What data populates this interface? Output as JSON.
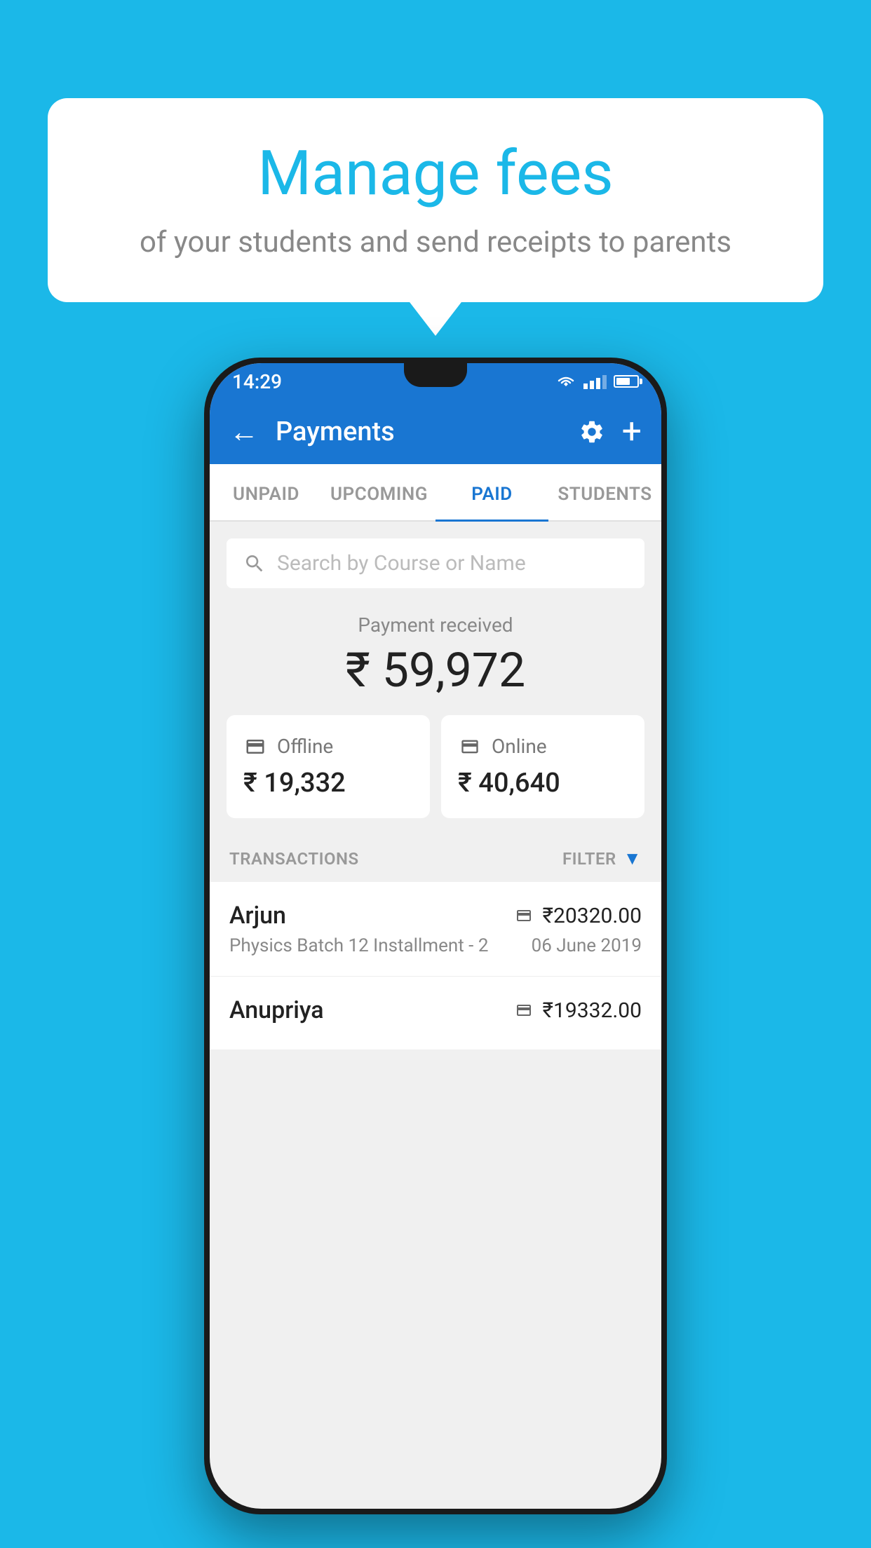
{
  "background_color": "#1bb8e8",
  "speech_bubble": {
    "title": "Manage fees",
    "subtitle": "of your students and send receipts to parents"
  },
  "status_bar": {
    "time": "14:29"
  },
  "app_bar": {
    "title": "Payments",
    "back_label": "←",
    "settings_label": "⚙",
    "add_label": "+"
  },
  "tabs": [
    {
      "label": "UNPAID",
      "active": false
    },
    {
      "label": "UPCOMING",
      "active": false
    },
    {
      "label": "PAID",
      "active": true
    },
    {
      "label": "STUDENTS",
      "active": false
    }
  ],
  "search": {
    "placeholder": "Search by Course or Name"
  },
  "payment_summary": {
    "label": "Payment received",
    "amount": "₹ 59,972",
    "offline": {
      "label": "Offline",
      "amount": "₹ 19,332"
    },
    "online": {
      "label": "Online",
      "amount": "₹ 40,640"
    }
  },
  "transactions_section": {
    "label": "TRANSACTIONS",
    "filter_label": "FILTER"
  },
  "transactions": [
    {
      "name": "Arjun",
      "description": "Physics Batch 12 Installment - 2",
      "amount": "₹20320.00",
      "date": "06 June 2019",
      "payment_type": "card"
    },
    {
      "name": "Anupriya",
      "description": "",
      "amount": "₹19332.00",
      "date": "",
      "payment_type": "cash"
    }
  ]
}
